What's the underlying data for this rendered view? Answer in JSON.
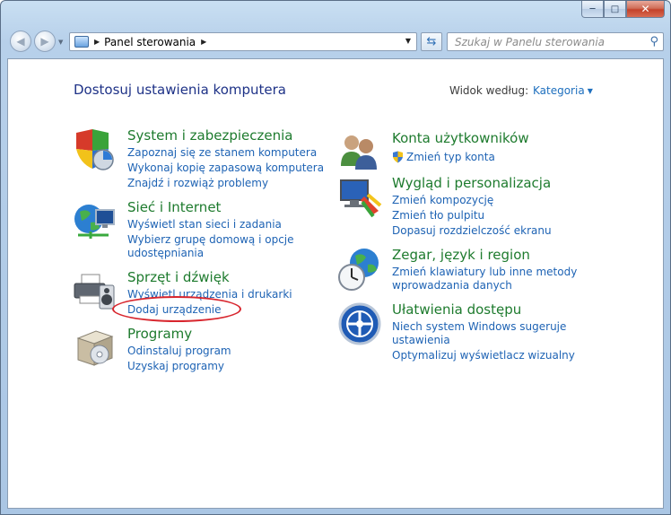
{
  "window": {
    "min_glyph": "─",
    "max_glyph": "□",
    "close_glyph": "✕"
  },
  "nav": {
    "back_glyph": "◀",
    "forward_glyph": "▶",
    "address_path": "Panel sterowania",
    "address_sep": "▶",
    "search_placeholder": "Szukaj w Panelu sterowania"
  },
  "main": {
    "heading": "Dostosuj ustawienia komputera",
    "view_by_label": "Widok według:",
    "view_by_value": "Kategoria"
  },
  "categories_left": [
    {
      "title": "System i zabezpieczenia",
      "icon": "system-security-shield-icon",
      "links": [
        "Zapoznaj się ze stanem komputera",
        "Wykonaj kopię zapasową komputera",
        "Znajdź i rozwiąż problemy"
      ]
    },
    {
      "title": "Sieć i Internet",
      "icon": "network-globe-icon",
      "links": [
        "Wyświetl stan sieci i zadania",
        "Wybierz grupę domową i opcje",
        "udostępniania"
      ]
    },
    {
      "title": "Sprzęt i dźwięk",
      "icon": "printer-speaker-icon",
      "links": [
        "Wyświetl urządzenia i drukarki",
        "Dodaj urządzenie"
      ]
    },
    {
      "title": "Programy",
      "icon": "programs-box-icon",
      "links": [
        "Odinstaluj program",
        "Uzyskaj programy"
      ]
    }
  ],
  "categories_right": [
    {
      "title": "Konta użytkowników",
      "icon": "users-icon",
      "links": [
        "Zmień typ konta"
      ]
    },
    {
      "title": "Wygląd i personalizacja",
      "icon": "monitor-paint-icon",
      "links": [
        "Zmień kompozycję",
        "Zmień tło pulpitu",
        "Dopasuj rozdzielczość ekranu"
      ]
    },
    {
      "title": "Zegar, język i region",
      "icon": "clock-globe-icon",
      "links": [
        "Zmień klawiatury lub inne metody",
        "wprowadzania danych"
      ]
    },
    {
      "title": "Ułatwienia dostępu",
      "icon": "accessibility-icon",
      "links": [
        "Niech system Windows sugeruje",
        "ustawienia",
        "Optymalizuj wyświetlacz wizualny"
      ]
    }
  ],
  "colors": {
    "title_green": "#1e7b2e",
    "link_blue": "#1e63b4",
    "heading_navy": "#1e3287",
    "annotation_red": "#d8262e"
  }
}
